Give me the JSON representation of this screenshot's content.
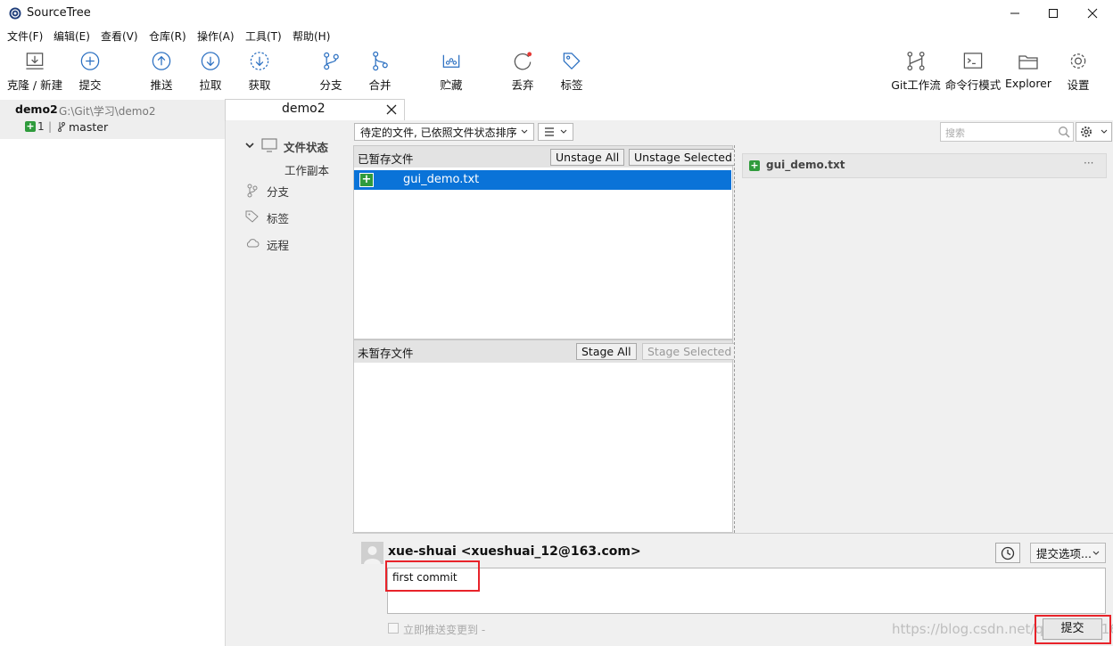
{
  "app": {
    "title": "SourceTree"
  },
  "window_controls": {
    "minimize": "—",
    "maximize": "☐",
    "close": "✕"
  },
  "menu": [
    "文件(F)",
    "编辑(E)",
    "查看(V)",
    "仓库(R)",
    "操作(A)",
    "工具(T)",
    "帮助(H)"
  ],
  "toolbar": {
    "clone": "克隆 / 新建",
    "commit": "提交",
    "push": "推送",
    "pull": "拉取",
    "fetch": "获取",
    "branch": "分支",
    "merge": "合并",
    "stash": "贮藏",
    "discard": "丢弃",
    "tag": "标签",
    "git_flow": "Git工作流",
    "terminal": "命令行模式",
    "explorer": "Explorer",
    "settings": "设置"
  },
  "repo": {
    "name": "demo2",
    "path": "G:\\Git\\学习\\demo2",
    "added_count": "1",
    "separator": "|",
    "branch": "master"
  },
  "tab": {
    "label": "demo2",
    "close": "✕"
  },
  "sidebar": {
    "file_status": "文件状态",
    "working_copy": "工作副本",
    "branches": "分支",
    "tags": "标签",
    "remotes": "远程"
  },
  "filter": {
    "sort_label": "待定的文件, 已依照文件状态排序",
    "search_placeholder": "搜索"
  },
  "staged": {
    "title": "已暂存文件",
    "unstage_all": "Unstage All",
    "unstage_selected": "Unstage Selected",
    "files": [
      "gui_demo.txt"
    ]
  },
  "unstaged": {
    "title": "未暂存文件",
    "stage_all": "Stage All",
    "stage_selected": "Stage Selected"
  },
  "diff": {
    "file": "gui_demo.txt",
    "more": "···"
  },
  "commit": {
    "author": "xue-shuai <xueshuai_12@163.com>",
    "message": "first commit",
    "options": "提交选项...",
    "push_checkbox": "立即推送变更到 -",
    "submit": "提交"
  },
  "watermark": "https://blog.csdn.net/qq_41139161",
  "colors": {
    "accent": "#0a73d8",
    "added": "#2f9b3c",
    "highlight": "#e8232a"
  }
}
